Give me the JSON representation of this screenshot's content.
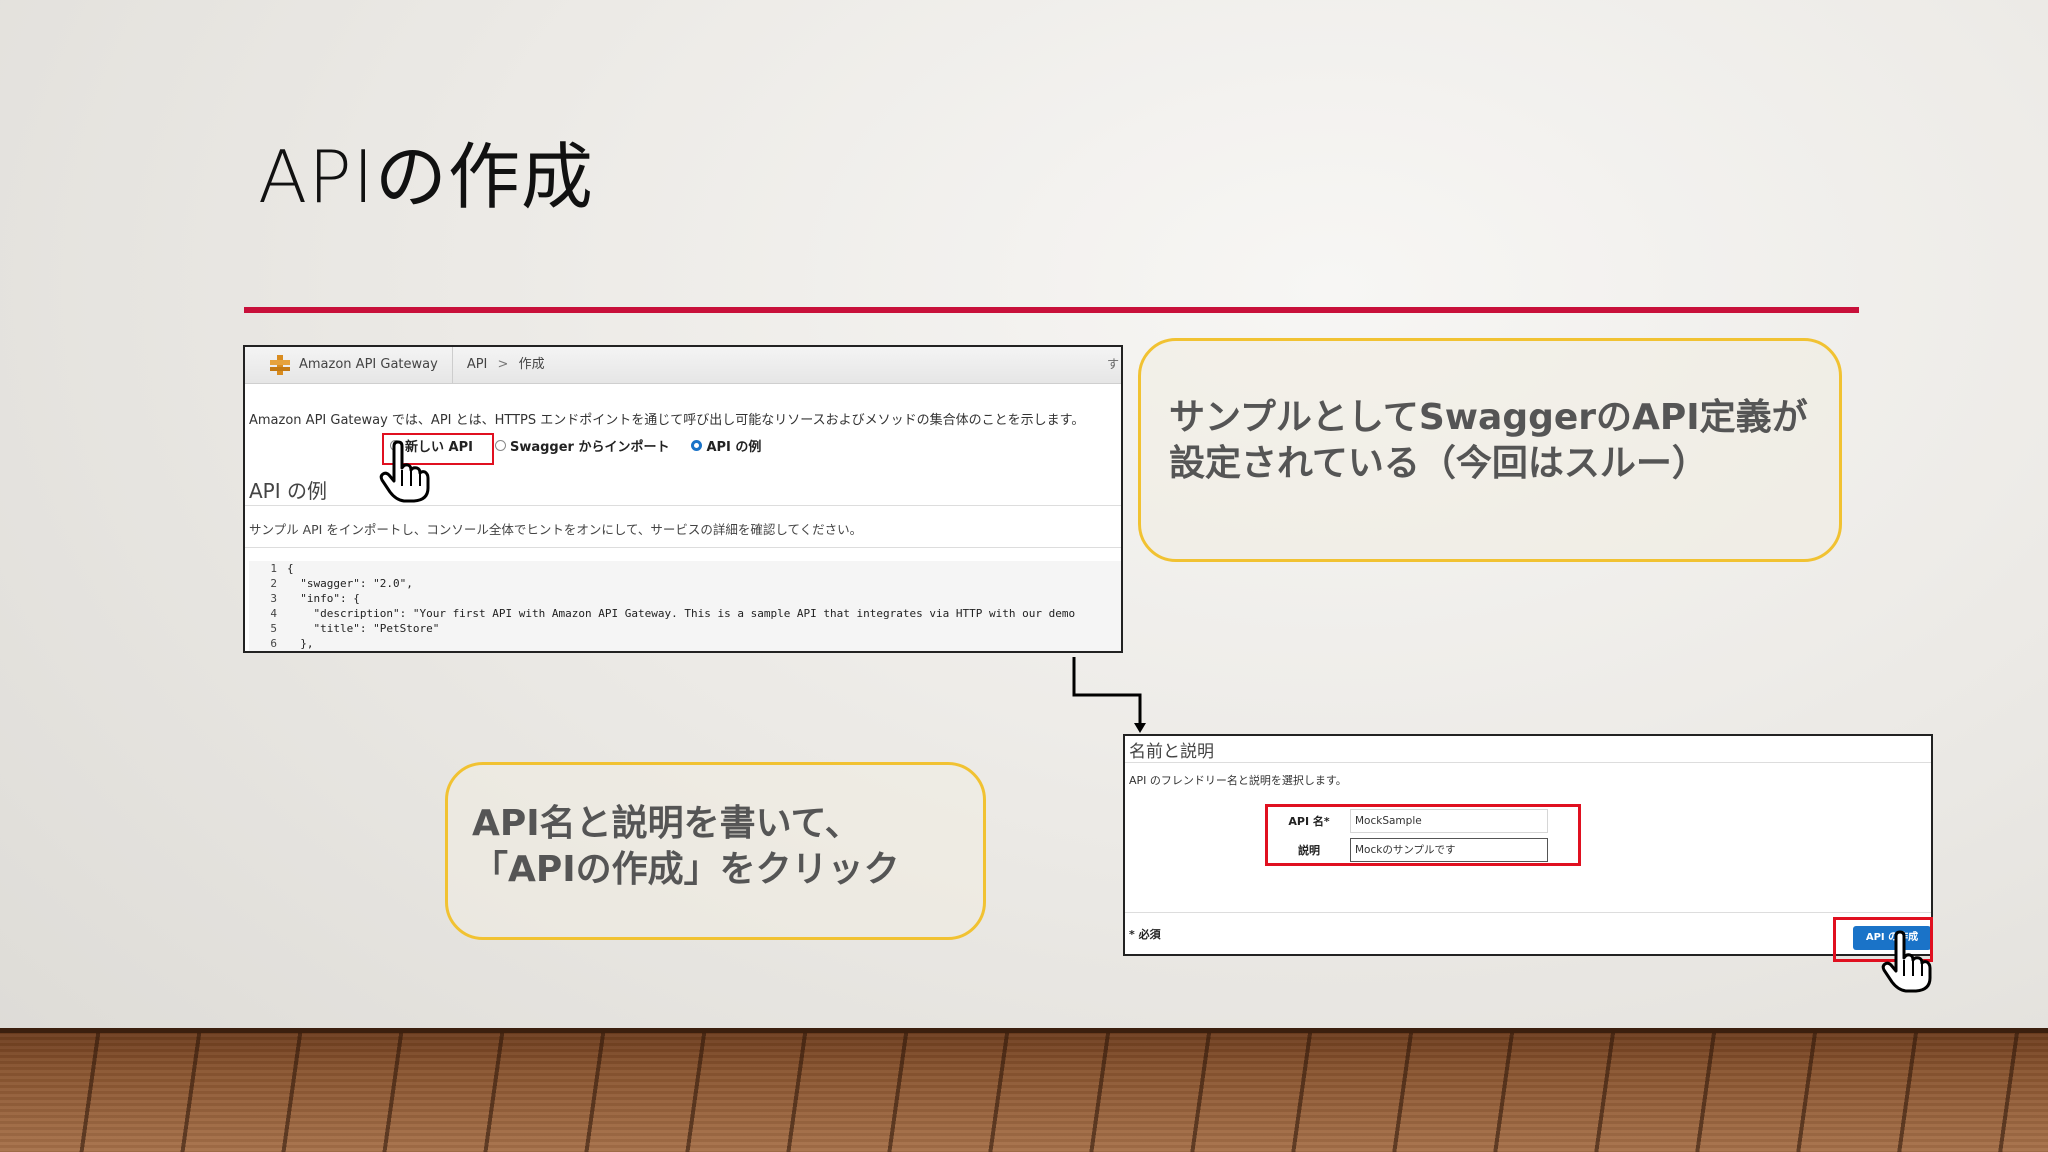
{
  "slide": {
    "title": "APIの作成",
    "accent_color": "#c8103a"
  },
  "screenshot1": {
    "breadcrumb": [
      "Amazon API Gateway",
      "API",
      "作成"
    ],
    "breadcrumb_sep": ">",
    "scroll_stub": "す",
    "intro": "Amazon API Gateway では、API とは、HTTPS エンドポイントを通じて呼び出し可能なリソースおよびメソッドの集合体のことを示します。",
    "options": [
      "新しい API",
      "Swagger からインポート",
      "API の例"
    ],
    "selected_option": "API の例",
    "section_title": "API の例",
    "section_desc": "サンプル API をインポートし、コンソール全体でヒントをオンにして、サービスの詳細を確認してください。",
    "code_lines": [
      {
        "n": "1",
        "text": "{"
      },
      {
        "n": "2",
        "text": "  \"swagger\": \"2.0\","
      },
      {
        "n": "3",
        "text": "  \"info\": {"
      },
      {
        "n": "4",
        "text": "    \"description\": \"Your first API with Amazon API Gateway. This is a sample API that integrates via HTTP with our demo"
      },
      {
        "n": "5",
        "text": "    \"title\": \"PetStore\""
      },
      {
        "n": "6",
        "text": "  },"
      }
    ]
  },
  "callout1": {
    "line1": "サンプルとしてSwaggerのAPI定義が",
    "line2": "設定されている（今回はスルー）"
  },
  "callout2": {
    "line1": "API名と説明を書いて、",
    "line2": "「APIの作成」をクリック"
  },
  "screenshot2": {
    "section_title": "名前と説明",
    "desc": "API のフレンドリー名と説明を選択します。",
    "api_name_label": "API 名*",
    "api_name_value": "MockSample",
    "desc_label": "説明",
    "desc_value": "Mockのサンプルです",
    "required_note": "* 必須",
    "create_button": "API の作成"
  },
  "colors": {
    "highlight_red": "#e01020",
    "callout_border": "#f1c232",
    "button_blue": "#1a73c8"
  }
}
